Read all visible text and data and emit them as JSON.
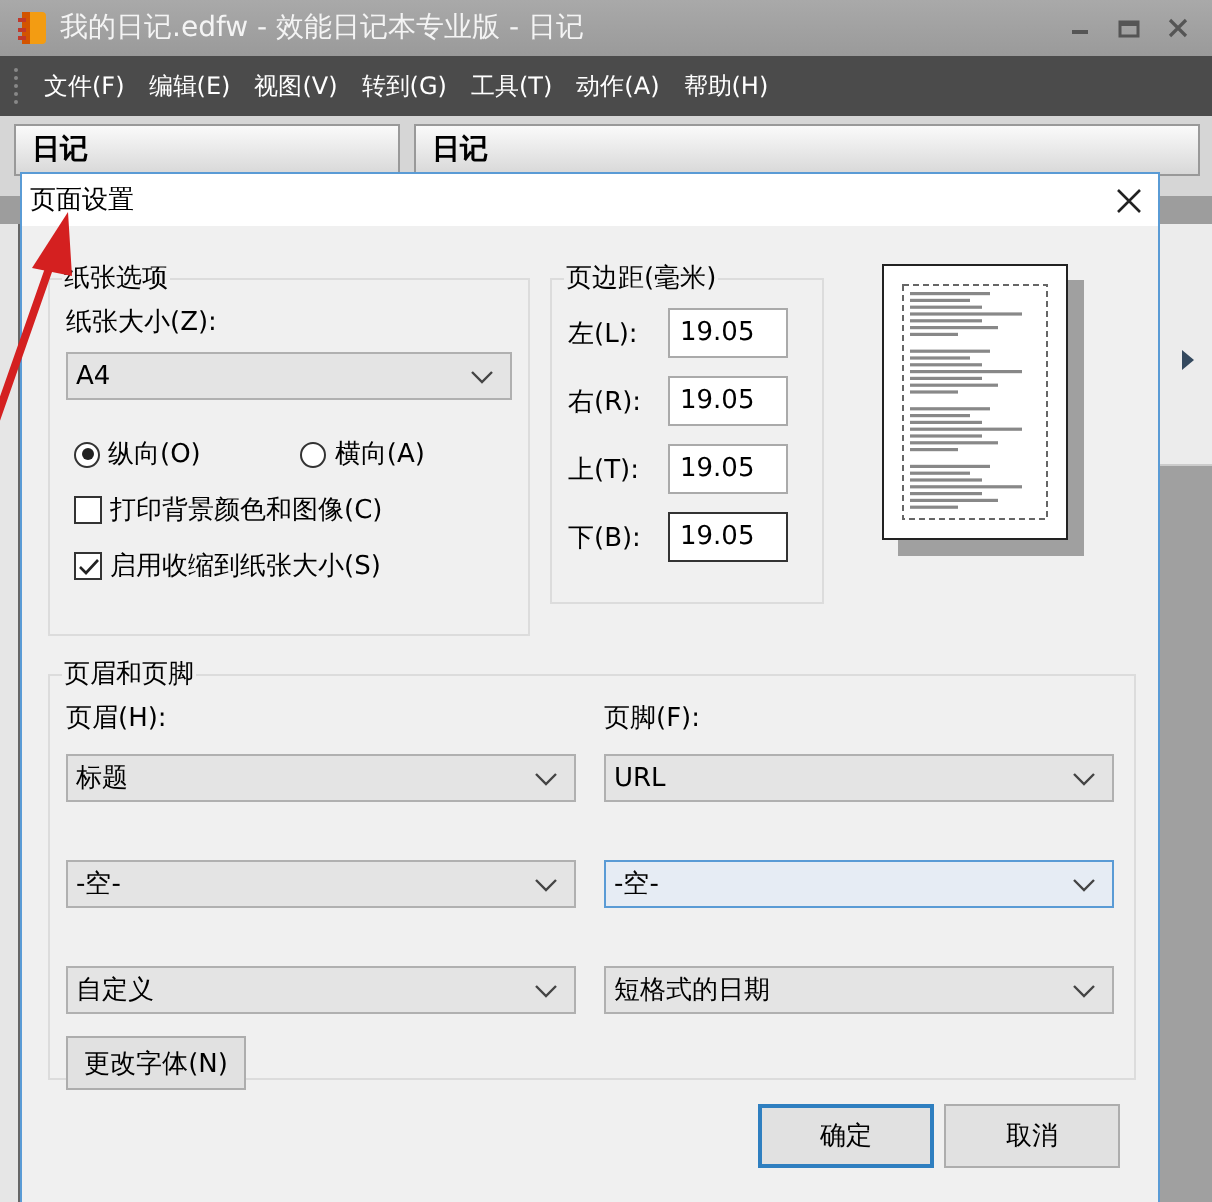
{
  "window": {
    "title": "我的日记.edfw - 效能日记本专业版 - 日记"
  },
  "menu": [
    "文件(F)",
    "编辑(E)",
    "视图(V)",
    "转到(G)",
    "工具(T)",
    "动作(A)",
    "帮助(H)"
  ],
  "panels": [
    {
      "title": "日记"
    },
    {
      "title": "日记"
    }
  ],
  "dialog": {
    "title": "页面设置",
    "paper": {
      "title": "纸张选项",
      "size_label": "纸张大小(Z):",
      "size": "A4",
      "orientation": [
        {
          "label": "纵向(O)",
          "selected": true
        },
        {
          "label": "横向(A)",
          "selected": false
        }
      ],
      "options": [
        {
          "label": "打印背景颜色和图像(C)",
          "checked": false
        },
        {
          "label": "启用收缩到纸张大小(S)",
          "checked": true
        }
      ]
    },
    "margins": {
      "title": "页边距(毫米)",
      "fields": [
        {
          "label": "左(L):",
          "value": "19.05",
          "focused": false
        },
        {
          "label": "右(R):",
          "value": "19.05",
          "focused": false
        },
        {
          "label": "上(T):",
          "value": "19.05",
          "focused": false
        },
        {
          "label": "下(B):",
          "value": "19.05",
          "focused": true
        }
      ]
    },
    "header_footer": {
      "title": "页眉和页脚",
      "header_label": "页眉(H):",
      "footer_label": "页脚(F):",
      "header": [
        {
          "value": "标题",
          "focused": false
        },
        {
          "value": "-空-",
          "focused": false
        },
        {
          "value": "自定义",
          "focused": false
        }
      ],
      "footer": [
        {
          "value": "URL",
          "focused": false
        },
        {
          "value": "-空-",
          "focused": true
        },
        {
          "value": "短格式的日期",
          "focused": false
        }
      ]
    },
    "font_button": "更改字体(N)",
    "buttons": [
      {
        "label": "确定",
        "default": true
      },
      {
        "label": "取消",
        "default": false
      }
    ]
  }
}
